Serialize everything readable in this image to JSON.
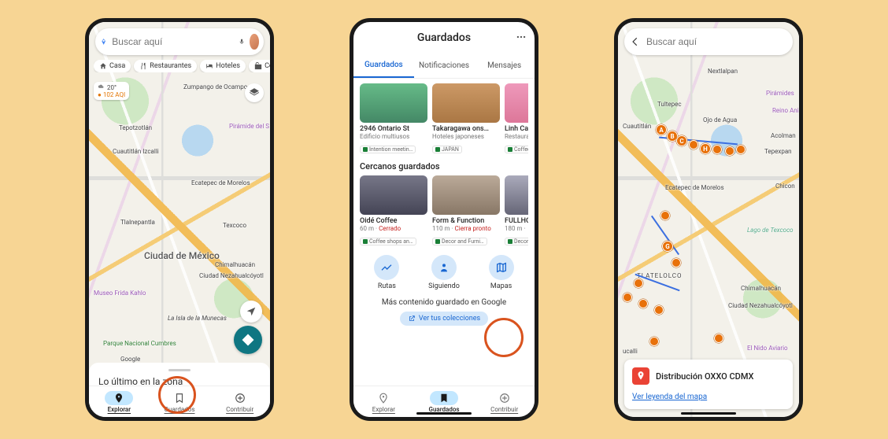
{
  "screen1": {
    "search_placeholder": "Buscar aquí",
    "chips": {
      "casa": "Casa",
      "restaurantes": "Restaurantes",
      "hoteles": "Hoteles",
      "compras": "Compras"
    },
    "weather": {
      "temp": "20°",
      "aqi": "102 AQI"
    },
    "map_labels": {
      "zumpango": "Zumpango de Ocampo",
      "tepotzotlan": "Tepotzotlán",
      "cuautitlan": "Cuautitlán Izcalli",
      "ecatepec": "Ecatepec de Morelos",
      "tlalnepantla": "Tlalnepantla",
      "cdmx": "Ciudad de México",
      "chimalhuacan": "Chimalhuacán",
      "neza": "Ciudad Nezahualcóyotl",
      "frida": "Museo Frida Kahlo",
      "munecas": "La Isla de la Munecas",
      "parque": "Parque Nacional Cumbres",
      "texcoco": "Texcoco",
      "piramide": "Pirámide del S",
      "google": "Google"
    },
    "sheet_title": "Lo último en la zona",
    "nav": {
      "explore": "Explorar",
      "saved": "Guardados",
      "contribute": "Contribuir"
    }
  },
  "screen2": {
    "header": "Guardados",
    "tabs": {
      "saved": "Guardados",
      "notifications": "Notificaciones",
      "messages": "Mensajes"
    },
    "row1": [
      {
        "title": "2946 Ontario St",
        "sub": "Edificio multiusos",
        "tag": "Intention meetin…"
      },
      {
        "title": "Takaragawa ons…",
        "sub": "Hoteles japoneses",
        "tag": "JAPAN"
      },
      {
        "title": "Linh Café",
        "sub": "Restaurant…",
        "tag": "Coffee…"
      }
    ],
    "section2": "Cercanos guardados",
    "row2": [
      {
        "title": "Oidé Coffee",
        "dist": "60 m · ",
        "status": "Cerrado",
        "tag": "Coffee shops an…"
      },
      {
        "title": "Form & Function",
        "dist": "110 m · ",
        "status": "Cierra pronto",
        "tag": "Decor and Furni…"
      },
      {
        "title": "FULLHOU…",
        "dist": "180 m · ",
        "status": "",
        "tag": "Decor …"
      }
    ],
    "quick": {
      "rutas": "Rutas",
      "siguiendo": "Siguiendo",
      "mapas": "Mapas"
    },
    "more_content": "Más contenido guardado en Google",
    "collections": "Ver tus colecciones",
    "nav": {
      "explore": "Explorar",
      "saved": "Guardados",
      "contribute": "Contribuir"
    }
  },
  "screen3": {
    "search_placeholder": "Buscar aquí",
    "map_labels": {
      "nextlalpan": "Nextlalpan",
      "tultepec": "Tultepec",
      "cuautitlan": "Cuautitlán",
      "ojo": "Ojo de Agua",
      "piramide": "Pirámides",
      "reino": "Reino Animal",
      "acolman": "Acolman",
      "tepexpan": "Tepexpan",
      "chicon": "Chicon",
      "ecatepec": "Ecatepec de Morelos",
      "texcoco": "Lago de Texcoco",
      "tlatelolco": "TLATELOLCO",
      "chimalhuacan": "Chimalhuacán",
      "neza": "Ciudad Nezahualcóyotl",
      "nido": "El Nido Aviario",
      "ucalli": "ucalli"
    },
    "card_title": "Distribución OXXO CDMX",
    "legend_link": "Ver leyenda del mapa"
  }
}
